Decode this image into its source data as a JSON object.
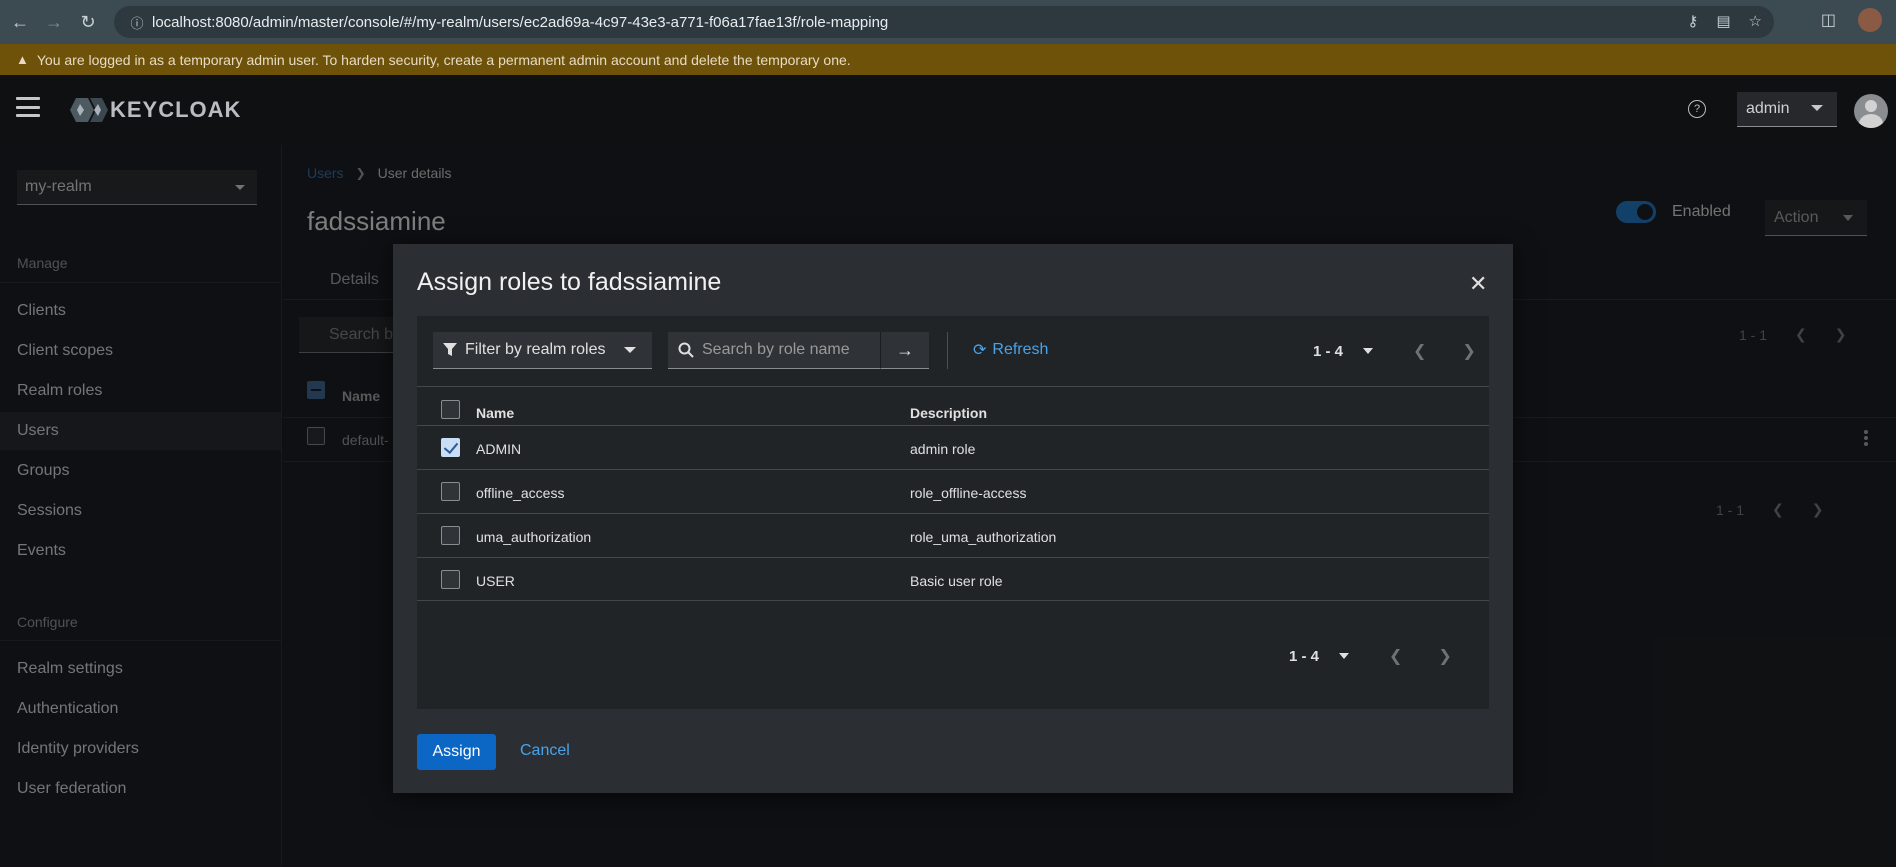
{
  "browser": {
    "url": "localhost:8080/admin/master/console/#/my-realm/users/ec2ad69a-4c97-43e3-a771-f06a17fae13f/role-mapping"
  },
  "warning": {
    "text": "You are logged in as a temporary admin user. To harden security, create a permanent admin account and delete the temporary one."
  },
  "masthead": {
    "logo_text": "KEYCLOAK",
    "user_menu": "admin"
  },
  "sidebar": {
    "realm": "my-realm",
    "manage_label": "Manage",
    "manage_items": [
      "Clients",
      "Client scopes",
      "Realm roles",
      "Users",
      "Groups",
      "Sessions",
      "Events"
    ],
    "configure_label": "Configure",
    "configure_items": [
      "Realm settings",
      "Authentication",
      "Identity providers",
      "User federation"
    ]
  },
  "page": {
    "breadcrumb_link": "Users",
    "breadcrumb_current": "User details",
    "title": "fadssiamine",
    "enabled_label": "Enabled",
    "action_label": "Action",
    "tab_details": "Details",
    "search_placeholder": "Search b",
    "col_name": "Name",
    "row_name": "default-",
    "pager_top": "1 - 1",
    "pager_bottom": "1 - 1"
  },
  "modal": {
    "title": "Assign roles to fadssiamine",
    "filter_label": "Filter by realm roles",
    "search_placeholder": "Search by role name",
    "refresh_label": "Refresh",
    "pager_top": "1 - 4",
    "pager_bottom": "1 - 4",
    "columns": {
      "name": "Name",
      "description": "Description"
    },
    "rows": [
      {
        "name": "ADMIN",
        "description": "admin role",
        "checked": true
      },
      {
        "name": "offline_access",
        "description": "role_offline-access",
        "checked": false
      },
      {
        "name": "uma_authorization",
        "description": "role_uma_authorization",
        "checked": false
      },
      {
        "name": "USER",
        "description": "Basic user role",
        "checked": false
      }
    ],
    "assign_label": "Assign",
    "cancel_label": "Cancel"
  },
  "colors": {
    "accent": "#0b66c4",
    "link": "#4aa3e8",
    "warning_bg": "#6e5209",
    "masthead_bg": "#0f1012"
  }
}
